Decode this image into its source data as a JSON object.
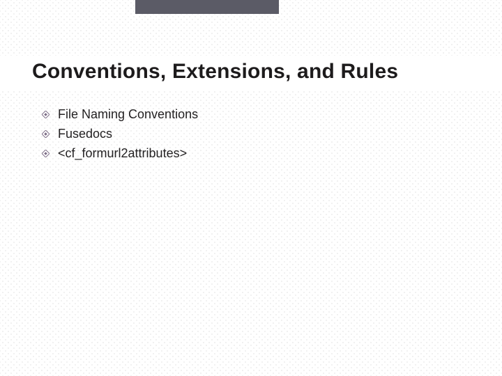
{
  "colors": {
    "topbar": "#5b5b66",
    "bullet": "#7a6a84",
    "text": "#1d1b1c"
  },
  "title": "Conventions, Extensions, and Rules",
  "bullets": {
    "items": [
      {
        "label": "File Naming Conventions"
      },
      {
        "label": "Fusedocs"
      },
      {
        "label": "<cf_formurl2attributes>"
      }
    ]
  }
}
